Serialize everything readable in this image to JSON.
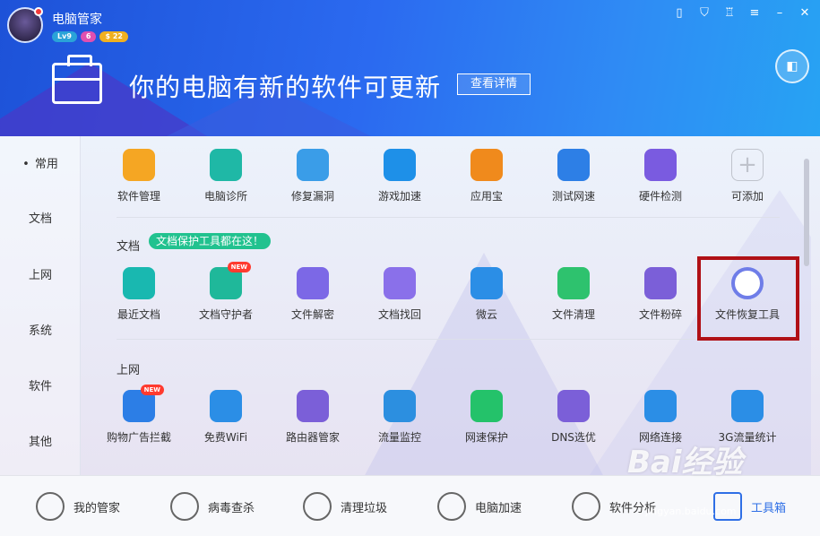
{
  "app": {
    "title": "电脑管家",
    "badges": [
      "Lv9",
      "6",
      "$ 22"
    ]
  },
  "window_controls": [
    "phone-icon",
    "shield-icon",
    "skin-icon",
    "menu-icon",
    "minimize-icon",
    "close-icon"
  ],
  "banner": {
    "headline": "你的电脑有新的软件可更新",
    "detail_button": "查看详情"
  },
  "sidebar": {
    "items": [
      "常用",
      "文档",
      "上网",
      "系统",
      "软件",
      "其他"
    ],
    "active": "常用"
  },
  "sections": {
    "common": {
      "tools": [
        {
          "label": "软件管理",
          "icon": "software-manager-icon",
          "color": "#f5a623"
        },
        {
          "label": "电脑诊所",
          "icon": "stethoscope-icon",
          "color": "#1fb8a6"
        },
        {
          "label": "修复漏洞",
          "icon": "windows-patch-icon",
          "color": "#3a9de8"
        },
        {
          "label": "游戏加速",
          "icon": "game-boost-icon",
          "color": "#1e90e8"
        },
        {
          "label": "应用宝",
          "icon": "app-store-icon",
          "color": "#f08a1c"
        },
        {
          "label": "测试网速",
          "icon": "speedometer-icon",
          "color": "#2d7fe6"
        },
        {
          "label": "硬件检测",
          "icon": "chip-icon",
          "color": "#7a5be0"
        },
        {
          "label": "可添加",
          "icon": "add-icon",
          "color": "#bfc3cc"
        }
      ]
    },
    "docs": {
      "title": "文档",
      "tip": "文档保护工具都在这！",
      "tools": [
        {
          "label": "最近文档",
          "icon": "recent-docs-icon",
          "color": "#19b8b0"
        },
        {
          "label": "文档守护者",
          "icon": "doc-guard-icon",
          "color": "#1fb89a",
          "badge": "NEW"
        },
        {
          "label": "文件解密",
          "icon": "folder-lock-icon",
          "color": "#7c68e6"
        },
        {
          "label": "文档找回",
          "icon": "doc-search-icon",
          "color": "#8a70ea"
        },
        {
          "label": "微云",
          "icon": "cloud-icon",
          "color": "#2b8ee6"
        },
        {
          "label": "文件清理",
          "icon": "trash-icon",
          "color": "#2ec26e"
        },
        {
          "label": "文件粉碎",
          "icon": "shredder-icon",
          "color": "#7b5fd8"
        },
        {
          "label": "文件恢复工具",
          "icon": "restore-clock-icon",
          "color": "#6f7de8"
        }
      ]
    },
    "web": {
      "title": "上网",
      "tools": [
        {
          "label": "购物广告拦截",
          "icon": "ad-block-icon",
          "color": "#2c7ee6",
          "badge": "NEW"
        },
        {
          "label": "免费WiFi",
          "icon": "wifi-icon",
          "color": "#2b8ee6"
        },
        {
          "label": "路由器管家",
          "icon": "router-icon",
          "color": "#7b5fd8"
        },
        {
          "label": "流量监控",
          "icon": "monitor-icon",
          "color": "#2c8fe0"
        },
        {
          "label": "网速保护",
          "icon": "shield-check-icon",
          "color": "#24c26a"
        },
        {
          "label": "DNS选优",
          "icon": "server-icon",
          "color": "#7b5fd8"
        },
        {
          "label": "网络连接",
          "icon": "globe-icon",
          "color": "#2b8ee6"
        },
        {
          "label": "3G流量统计",
          "icon": "3g-icon",
          "color": "#2b8ee6"
        }
      ]
    }
  },
  "footer": {
    "items": [
      {
        "label": "我的管家",
        "icon": "avatar-icon"
      },
      {
        "label": "病毒查杀",
        "icon": "virus-scan-icon"
      },
      {
        "label": "清理垃圾",
        "icon": "vacuum-icon"
      },
      {
        "label": "电脑加速",
        "icon": "rocket-icon"
      },
      {
        "label": "软件分析",
        "icon": "analysis-icon"
      },
      {
        "label": "工具箱",
        "icon": "toolbox-icon"
      }
    ]
  },
  "watermark": {
    "text": "Bai经验",
    "url": "jingyan.baidu.com"
  }
}
